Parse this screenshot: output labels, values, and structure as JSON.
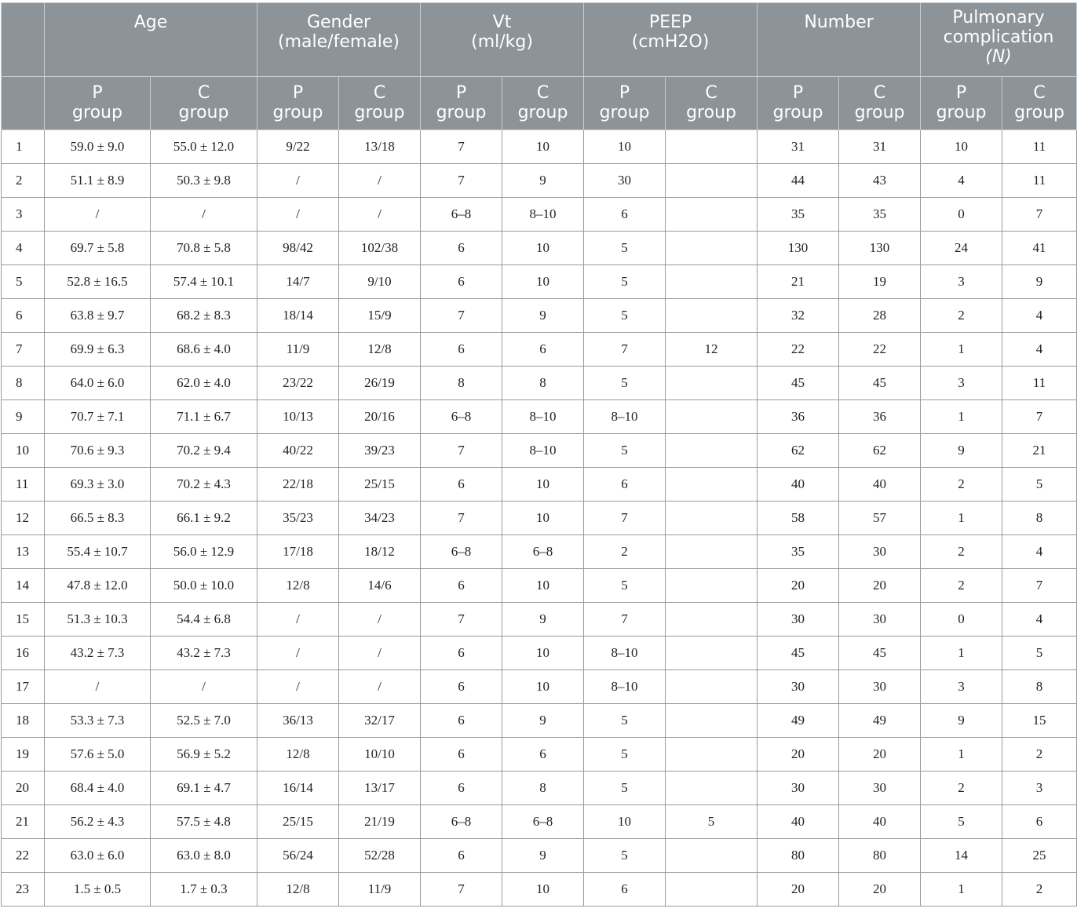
{
  "header": {
    "groups": [
      {
        "key": "age",
        "lines": [
          "Age"
        ]
      },
      {
        "key": "gender",
        "lines": [
          "Gender",
          "(male/female)"
        ]
      },
      {
        "key": "vt",
        "lines": [
          "Vt",
          "(ml/kg)"
        ]
      },
      {
        "key": "peep",
        "lines": [
          "PEEP",
          "(cmH2O)"
        ]
      },
      {
        "key": "number",
        "lines": [
          "Number"
        ]
      },
      {
        "key": "pulmonary",
        "lines": [
          "Pulmonary",
          "complication",
          "(N)"
        ]
      }
    ],
    "sub": {
      "p": [
        "P",
        "group"
      ],
      "c": [
        "C",
        "group"
      ]
    }
  },
  "rows": [
    [
      "1",
      "59.0 ± 9.0",
      "55.0 ± 12.0",
      "9/22",
      "13/18",
      "7",
      "10",
      "10",
      "",
      "31",
      "31",
      "10",
      "11"
    ],
    [
      "2",
      "51.1 ± 8.9",
      "50.3 ± 9.8",
      "/",
      "/",
      "7",
      "9",
      "30",
      "",
      "44",
      "43",
      "4",
      "11"
    ],
    [
      "3",
      "/",
      "/",
      "/",
      "/",
      "6–8",
      "8–10",
      "6",
      "",
      "35",
      "35",
      "0",
      "7"
    ],
    [
      "4",
      "69.7 ± 5.8",
      "70.8 ± 5.8",
      "98/42",
      "102/38",
      "6",
      "10",
      "5",
      "",
      "130",
      "130",
      "24",
      "41"
    ],
    [
      "5",
      "52.8 ± 16.5",
      "57.4 ± 10.1",
      "14/7",
      "9/10",
      "6",
      "10",
      "5",
      "",
      "21",
      "19",
      "3",
      "9"
    ],
    [
      "6",
      "63.8 ± 9.7",
      "68.2 ± 8.3",
      "18/14",
      "15/9",
      "7",
      "9",
      "5",
      "",
      "32",
      "28",
      "2",
      "4"
    ],
    [
      "7",
      "69.9 ± 6.3",
      "68.6 ± 4.0",
      "11/9",
      "12/8",
      "6",
      "6",
      "7",
      "12",
      "22",
      "22",
      "1",
      "4"
    ],
    [
      "8",
      "64.0 ± 6.0",
      "62.0 ± 4.0",
      "23/22",
      "26/19",
      "8",
      "8",
      "5",
      "",
      "45",
      "45",
      "3",
      "11"
    ],
    [
      "9",
      "70.7 ± 7.1",
      "71.1 ± 6.7",
      "10/13",
      "20/16",
      "6–8",
      "8–10",
      "8–10",
      "",
      "36",
      "36",
      "1",
      "7"
    ],
    [
      "10",
      "70.6 ± 9.3",
      "70.2 ± 9.4",
      "40/22",
      "39/23",
      "7",
      "8–10",
      "5",
      "",
      "62",
      "62",
      "9",
      "21"
    ],
    [
      "11",
      "69.3 ± 3.0",
      "70.2 ± 4.3",
      "22/18",
      "25/15",
      "6",
      "10",
      "6",
      "",
      "40",
      "40",
      "2",
      "5"
    ],
    [
      "12",
      "66.5 ± 8.3",
      "66.1 ± 9.2",
      "35/23",
      "34/23",
      "7",
      "10",
      "7",
      "",
      "58",
      "57",
      "1",
      "8"
    ],
    [
      "13",
      "55.4 ± 10.7",
      "56.0 ± 12.9",
      "17/18",
      "18/12",
      "6–8",
      "6–8",
      "2",
      "",
      "35",
      "30",
      "2",
      "4"
    ],
    [
      "14",
      "47.8 ± 12.0",
      "50.0 ± 10.0",
      "12/8",
      "14/6",
      "6",
      "10",
      "5",
      "",
      "20",
      "20",
      "2",
      "7"
    ],
    [
      "15",
      "51.3 ± 10.3",
      "54.4 ± 6.8",
      "/",
      "/",
      "7",
      "9",
      "7",
      "",
      "30",
      "30",
      "0",
      "4"
    ],
    [
      "16",
      "43.2 ± 7.3",
      "43.2 ± 7.3",
      "/",
      "/",
      "6",
      "10",
      "8–10",
      "",
      "45",
      "45",
      "1",
      "5"
    ],
    [
      "17",
      "/",
      "/",
      "/",
      "/",
      "6",
      "10",
      "8–10",
      "",
      "30",
      "30",
      "3",
      "8"
    ],
    [
      "18",
      "53.3 ± 7.3",
      "52.5 ± 7.0",
      "36/13",
      "32/17",
      "6",
      "9",
      "5",
      "",
      "49",
      "49",
      "9",
      "15"
    ],
    [
      "19",
      "57.6 ± 5.0",
      "56.9 ± 5.2",
      "12/8",
      "10/10",
      "6",
      "6",
      "5",
      "",
      "20",
      "20",
      "1",
      "2"
    ],
    [
      "20",
      "68.4 ± 4.0",
      "69.1 ± 4.7",
      "16/14",
      "13/17",
      "6",
      "8",
      "5",
      "",
      "30",
      "30",
      "2",
      "3"
    ],
    [
      "21",
      "56.2 ± 4.3",
      "57.5 ± 4.8",
      "25/15",
      "21/19",
      "6–8",
      "6–8",
      "10",
      "5",
      "40",
      "40",
      "5",
      "6"
    ],
    [
      "22",
      "63.0 ± 6.0",
      "63.0 ± 8.0",
      "56/24",
      "52/28",
      "6",
      "9",
      "5",
      "",
      "80",
      "80",
      "14",
      "25"
    ],
    [
      "23",
      "1.5 ± 0.5",
      "1.7 ± 0.3",
      "12/8",
      "11/9",
      "7",
      "10",
      "6",
      "",
      "20",
      "20",
      "1",
      "2"
    ]
  ]
}
